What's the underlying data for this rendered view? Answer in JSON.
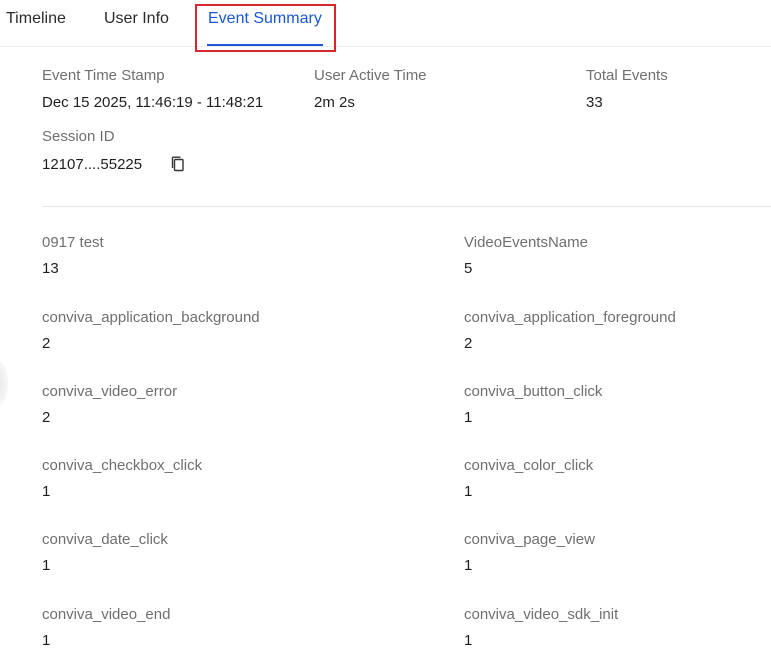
{
  "tabs": [
    {
      "label": "Timeline"
    },
    {
      "label": "User Info"
    },
    {
      "label": "Event Summary"
    }
  ],
  "summary": {
    "timestamp_label": "Event Time Stamp",
    "timestamp_value": "Dec 15 2025, 11:46:19 - 11:48:21",
    "active_label": "User Active Time",
    "active_value": "2m 2s",
    "total_label": "Total Events",
    "total_value": "33",
    "session_label": "Session ID",
    "session_value": "12107....55225"
  },
  "events": [
    {
      "name": "0917 test",
      "count": "13"
    },
    {
      "name": "VideoEventsName",
      "count": "5"
    },
    {
      "name": "conviva_application_background",
      "count": "2"
    },
    {
      "name": "conviva_application_foreground",
      "count": "2"
    },
    {
      "name": "conviva_video_error",
      "count": "2"
    },
    {
      "name": "conviva_button_click",
      "count": "1"
    },
    {
      "name": "conviva_checkbox_click",
      "count": "1"
    },
    {
      "name": "conviva_color_click",
      "count": "1"
    },
    {
      "name": "conviva_date_click",
      "count": "1"
    },
    {
      "name": "conviva_page_view",
      "count": "1"
    },
    {
      "name": "conviva_video_end",
      "count": "1"
    },
    {
      "name": "conviva_video_sdk_init",
      "count": "1"
    }
  ],
  "colors": {
    "active_tab": "#1a56db",
    "highlight": "#d9262c"
  }
}
